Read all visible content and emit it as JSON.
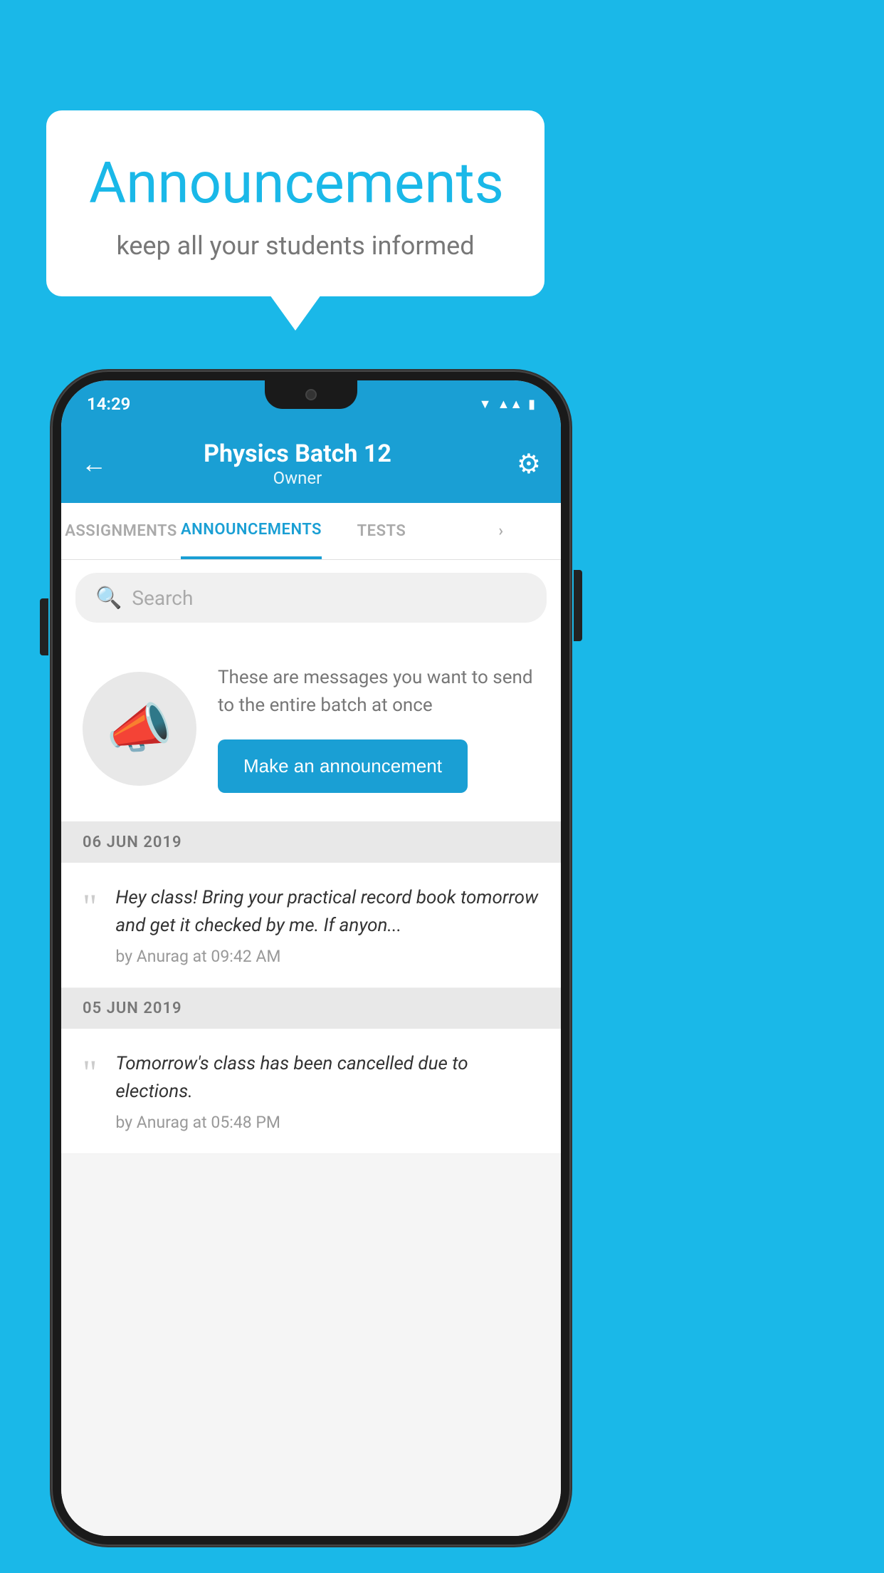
{
  "background": {
    "color": "#1ab8e8"
  },
  "speech_bubble": {
    "title": "Announcements",
    "subtitle": "keep all your students informed"
  },
  "status_bar": {
    "time": "14:29",
    "signal_icon": "▲",
    "wifi_icon": "▼"
  },
  "app_bar": {
    "title": "Physics Batch 12",
    "subtitle": "Owner",
    "back_label": "←",
    "settings_label": "⚙"
  },
  "tabs": [
    {
      "label": "ASSIGNMENTS",
      "active": false
    },
    {
      "label": "ANNOUNCEMENTS",
      "active": true
    },
    {
      "label": "TESTS",
      "active": false
    },
    {
      "label": "...",
      "active": false
    }
  ],
  "search": {
    "placeholder": "Search"
  },
  "announcement_prompt": {
    "description": "These are messages you want to send to the entire batch at once",
    "button_label": "Make an announcement"
  },
  "date_groups": [
    {
      "date": "06  JUN  2019",
      "announcements": [
        {
          "text": "Hey class! Bring your practical record book tomorrow and get it checked by me. If anyon...",
          "meta": "by Anurag at 09:42 AM"
        }
      ]
    },
    {
      "date": "05  JUN  2019",
      "announcements": [
        {
          "text": "Tomorrow's class has been cancelled due to elections.",
          "meta": "by Anurag at 05:48 PM"
        }
      ]
    }
  ],
  "icons": {
    "back": "←",
    "settings": "⚙",
    "search": "🔍",
    "megaphone": "📣",
    "quote": "““"
  }
}
